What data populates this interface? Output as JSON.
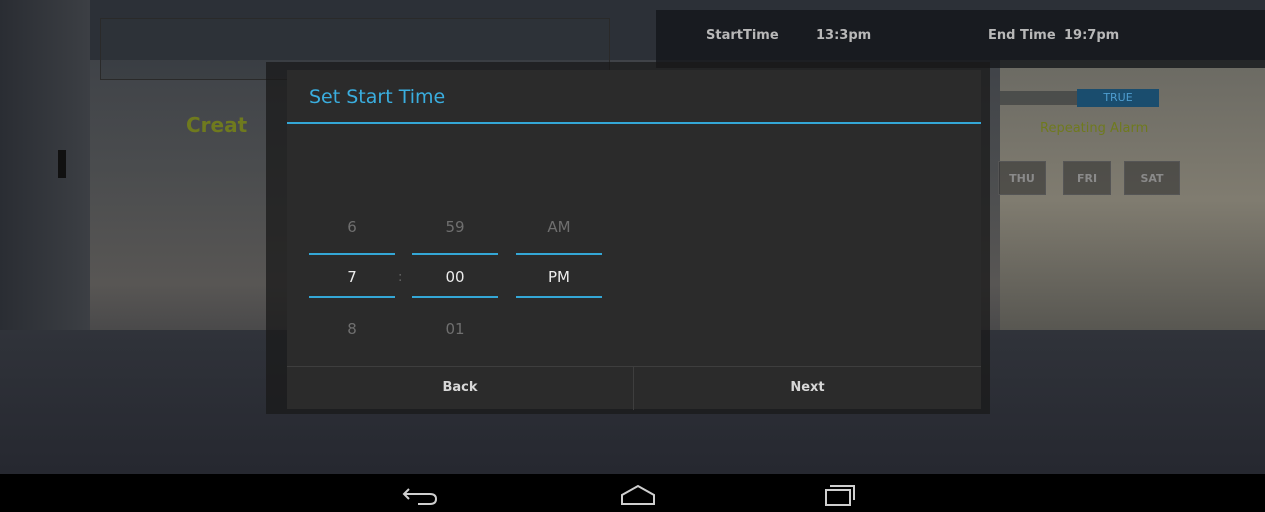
{
  "background_app": {
    "start_time_label": "StartTime",
    "start_time_value": "13:3pm",
    "end_time_label": "End Time",
    "end_time_value": "19:7pm",
    "create_title": "Creat",
    "toggle_value": "TRUE",
    "repeating_label": "Repeating Alarm",
    "days": [
      "THU",
      "FRI",
      "SAT"
    ]
  },
  "dialog": {
    "title": "Set Start Time",
    "picker": {
      "hour": {
        "prev": "6",
        "current": "7",
        "next": "8"
      },
      "separator": ":",
      "minute": {
        "prev": "59",
        "current": "00",
        "next": "01"
      },
      "ampm": {
        "prev": "AM",
        "current": "PM"
      }
    },
    "back_label": "Back",
    "next_label": "Next"
  },
  "navbar": {
    "icons": [
      "back-icon",
      "home-icon",
      "recent-apps-icon"
    ]
  },
  "colors": {
    "accent": "#34a7d6",
    "dialog_bg": "#2b2b2b",
    "title_olive": "#6f7a1e"
  }
}
